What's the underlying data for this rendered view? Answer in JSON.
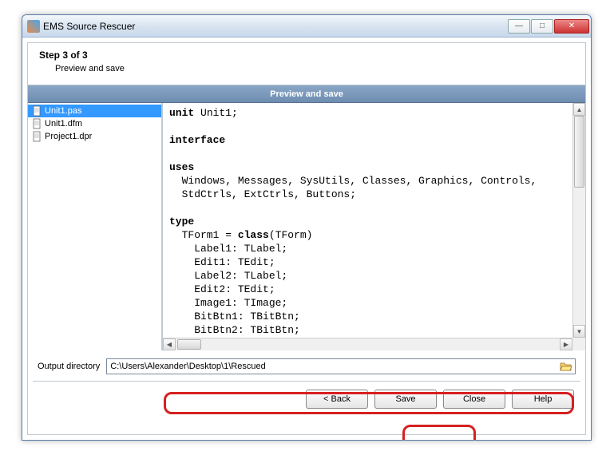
{
  "window": {
    "title": "EMS Source Rescuer"
  },
  "header": {
    "step": "Step 3 of 3",
    "subtitle": "Preview and save"
  },
  "banner": {
    "text": "Preview and save"
  },
  "tree": {
    "items": [
      {
        "label": "Unit1.pas",
        "selected": true
      },
      {
        "label": "Unit1.dfm",
        "selected": false
      },
      {
        "label": "Project1.dpr",
        "selected": false
      }
    ]
  },
  "code": {
    "lines": [
      "unit Unit1;",
      "",
      "interface",
      "",
      "uses",
      "  Windows, Messages, SysUtils, Classes, Graphics, Controls,",
      "  StdCtrls, ExtCtrls, Buttons;",
      "",
      "type",
      "  TForm1 = class(TForm)",
      "    Label1: TLabel;",
      "    Edit1: TEdit;",
      "    Label2: TLabel;",
      "    Edit2: TEdit;",
      "    Image1: TImage;",
      "    BitBtn1: TBitBtn;",
      "    BitBtn2: TBitBtn;"
    ],
    "bold_keywords": [
      "unit",
      "interface",
      "uses",
      "type",
      "class"
    ]
  },
  "output": {
    "label": "Output directory",
    "value": "C:\\Users\\Alexander\\Desktop\\1\\Rescued"
  },
  "buttons": {
    "back": "< Back",
    "save": "Save",
    "close": "Close",
    "help": "Help"
  }
}
